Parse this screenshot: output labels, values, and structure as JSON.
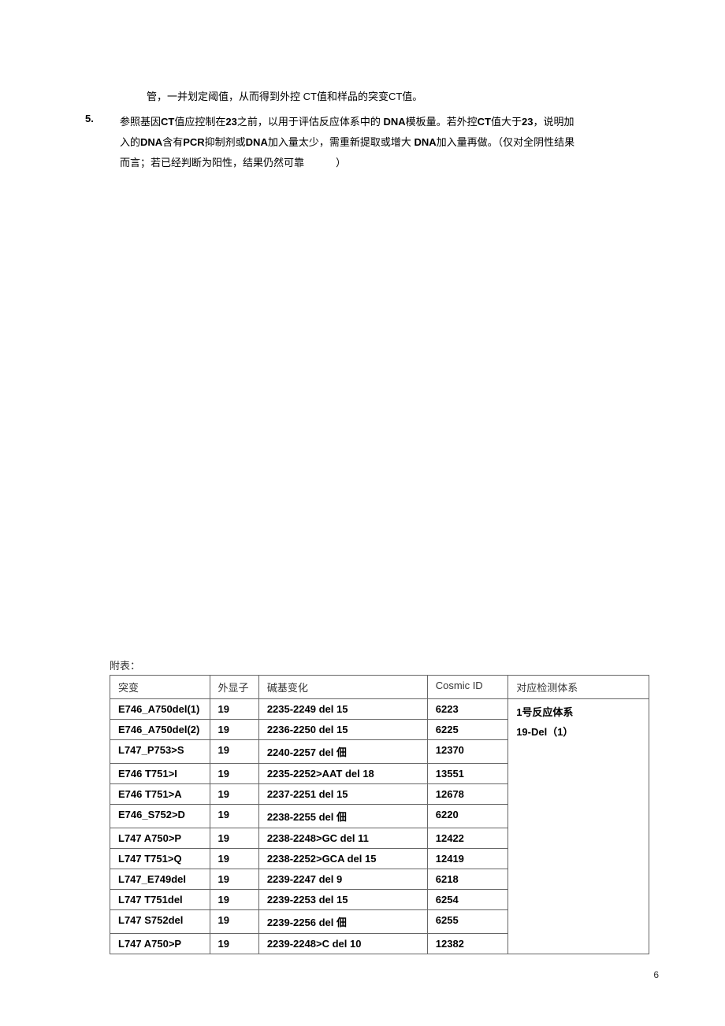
{
  "paragraphs": {
    "p4_cont": "管，一并划定阈值，从而得到外控 CT值和样品的突变CT值。",
    "p5_num": "5.",
    "p5_l1_a": "参照基因",
    "p5_l1_b": "CT",
    "p5_l1_c": "值应控制在",
    "p5_l1_d": "23",
    "p5_l1_e": "之前，以用于评估反应体系中的 ",
    "p5_l1_f": "DNA",
    "p5_l1_g": "模板量。若外控",
    "p5_l1_h": "CT",
    "p5_l1_i": "值大于",
    "p5_l1_j": "23",
    "p5_l1_k": "，说明加",
    "p5_l2_a": "入的",
    "p5_l2_b": "DNA",
    "p5_l2_c": "含有",
    "p5_l2_d": "PCR",
    "p5_l2_e": "抑制剂或",
    "p5_l2_f": "DNA",
    "p5_l2_g": "加入量太少，需重新提取或增大 ",
    "p5_l2_h": "DNA",
    "p5_l2_i": "加入量再做。（仅对全阴性结果",
    "p5_l3": "而言；若已经判断为阳性，结果仍然可靠",
    "p5_paren": "）"
  },
  "appendix_label": "附表：",
  "table": {
    "headers": {
      "mutation": "突变",
      "exon": "外显子",
      "base": "碱基变化",
      "cosmic": "Cosmic ID",
      "system": "对应检测体系"
    },
    "rows": [
      {
        "mutation": "E746_A750del(1)",
        "exon": "19",
        "base": "2235-2249 del 15",
        "cosmic": "6223"
      },
      {
        "mutation": "E746_A750del(2)",
        "exon": "19",
        "base": "2236-2250 del 15",
        "cosmic": "6225"
      },
      {
        "mutation": "L747_P753>S",
        "exon": "19",
        "base": "2240-2257 del 佃",
        "cosmic": "12370"
      },
      {
        "mutation": "E746 T751>I",
        "exon": "19",
        "base": "2235-2252>AAT del 18",
        "cosmic": "13551"
      },
      {
        "mutation": "E746 T751>A",
        "exon": "19",
        "base": "2237-2251 del 15",
        "cosmic": "12678"
      },
      {
        "mutation": "E746_S752>D",
        "exon": "19",
        "base": "2238-2255 del 佃",
        "cosmic": "6220"
      },
      {
        "mutation": "L747 A750>P",
        "exon": "19",
        "base": "2238-2248>GC del 11",
        "cosmic": "12422"
      },
      {
        "mutation": "L747 T751>Q",
        "exon": "19",
        "base": "2238-2252>GCA del 15",
        "cosmic": "12419"
      },
      {
        "mutation": "L747_E749del",
        "exon": "19",
        "base": "2239-2247 del 9",
        "cosmic": "6218"
      },
      {
        "mutation": "L747 T751del",
        "exon": "19",
        "base": "2239-2253 del 15",
        "cosmic": "6254"
      },
      {
        "mutation": "L747 S752del",
        "exon": "19",
        "base": "2239-2256 del 佃",
        "cosmic": "6255"
      },
      {
        "mutation": "L747 A750>P",
        "exon": "19",
        "base": "2239-2248>C del 10",
        "cosmic": "12382"
      }
    ],
    "system_l1": "1号反应体系",
    "system_l2": "19-Del（1）"
  },
  "page_number": "6"
}
